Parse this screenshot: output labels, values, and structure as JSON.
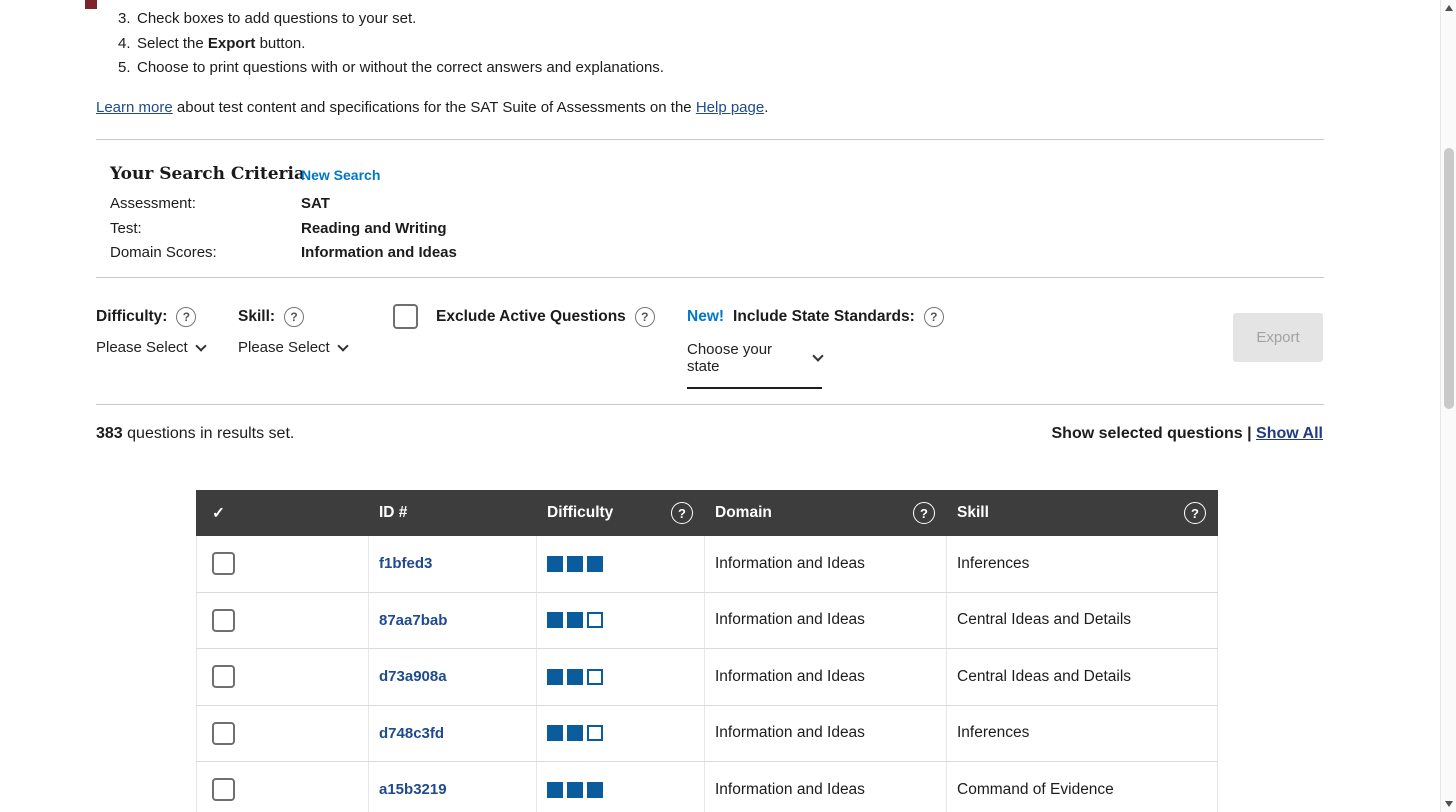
{
  "colors": {
    "accent_blue": "#0077c8",
    "link_navy": "#1f4b8e",
    "square_blue": "#0a5c9c",
    "table_header_bg": "#3d3d3d"
  },
  "instructions": {
    "item3_num": "3.",
    "item3": "Check boxes to add questions to your set.",
    "item4_num": "4.",
    "item4_pre": "Select the ",
    "item4_bold": "Export",
    "item4_post": " button.",
    "item5_num": "5.",
    "item5": "Choose to print questions with or without the correct answers and explanations."
  },
  "learn_more": {
    "link1": "Learn more",
    "middle": " about test content and specifications for the SAT Suite of Assessments on the ",
    "link2": "Help page",
    "end": "."
  },
  "criteria": {
    "title": "Your Search Criteria",
    "new_search": "New Search",
    "rows": [
      {
        "label": "Assessment:",
        "value": "SAT"
      },
      {
        "label": "Test:",
        "value": "Reading and Writing"
      },
      {
        "label": "Domain Scores:",
        "value": "Information and Ideas"
      }
    ]
  },
  "filters": {
    "difficulty_label": "Difficulty:",
    "skill_label": "Skill:",
    "please_select": "Please Select",
    "exclude_label": "Exclude Active Questions",
    "new_badge": "New!",
    "include_label": "Include State Standards:",
    "choose_state": "Choose your state",
    "export": "Export",
    "help": "?"
  },
  "results": {
    "count": "383",
    "text": " questions in results set.",
    "show_selected": "Show selected questions",
    "divider": " | ",
    "show_all": "Show All"
  },
  "table": {
    "headers": {
      "check": "✓",
      "id": "ID #",
      "difficulty": "Difficulty",
      "domain": "Domain",
      "skill": "Skill"
    },
    "rows": [
      {
        "id": "f1bfed3",
        "difficulty": 3,
        "domain": "Information and Ideas",
        "skill": "Inferences"
      },
      {
        "id": "87aa7bab",
        "difficulty": 2,
        "domain": "Information and Ideas",
        "skill": "Central Ideas and Details"
      },
      {
        "id": "d73a908a",
        "difficulty": 2,
        "domain": "Information and Ideas",
        "skill": "Central Ideas and Details"
      },
      {
        "id": "d748c3fd",
        "difficulty": 2,
        "domain": "Information and Ideas",
        "skill": "Inferences"
      },
      {
        "id": "a15b3219",
        "difficulty": 3,
        "domain": "Information and Ideas",
        "skill": "Command of Evidence"
      }
    ]
  }
}
